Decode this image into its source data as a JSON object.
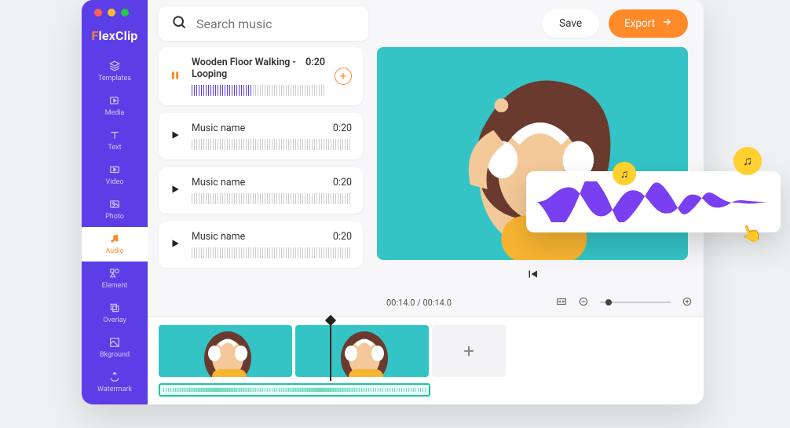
{
  "app": {
    "name_prefix": "F",
    "name_rest": "lexClip"
  },
  "sidebar": {
    "items": [
      {
        "label": "Templates",
        "icon": "templates-icon"
      },
      {
        "label": "Media",
        "icon": "media-icon"
      },
      {
        "label": "Text",
        "icon": "text-icon"
      },
      {
        "label": "Video",
        "icon": "video-icon"
      },
      {
        "label": "Photo",
        "icon": "photo-icon"
      },
      {
        "label": "Audio",
        "icon": "audio-icon",
        "active": true
      },
      {
        "label": "Element",
        "icon": "element-icon"
      },
      {
        "label": "Overlay",
        "icon": "overlay-icon"
      },
      {
        "label": "Bkground",
        "icon": "background-icon"
      },
      {
        "label": "Watermark",
        "icon": "watermark-icon"
      }
    ]
  },
  "topbar": {
    "search_placeholder": "Search music",
    "save_label": "Save",
    "export_label": "Export"
  },
  "tracks": [
    {
      "name": "Wooden Floor Walking - Looping",
      "duration": "0:20",
      "playing": true
    },
    {
      "name": "Music name",
      "duration": "0:20",
      "playing": false
    },
    {
      "name": "Music name",
      "duration": "0:20",
      "playing": false
    },
    {
      "name": "Music name",
      "duration": "0:20",
      "playing": false
    }
  ],
  "player": {
    "time_display": "00:14.0 / 00:14.0"
  },
  "timeline": {
    "add_label": "+"
  },
  "colors": {
    "brand": "#5b3ee6",
    "accent": "#ff8a2a",
    "teal": "#34c4c6",
    "yellow": "#ffd02e",
    "audio": "#1fc49e"
  }
}
